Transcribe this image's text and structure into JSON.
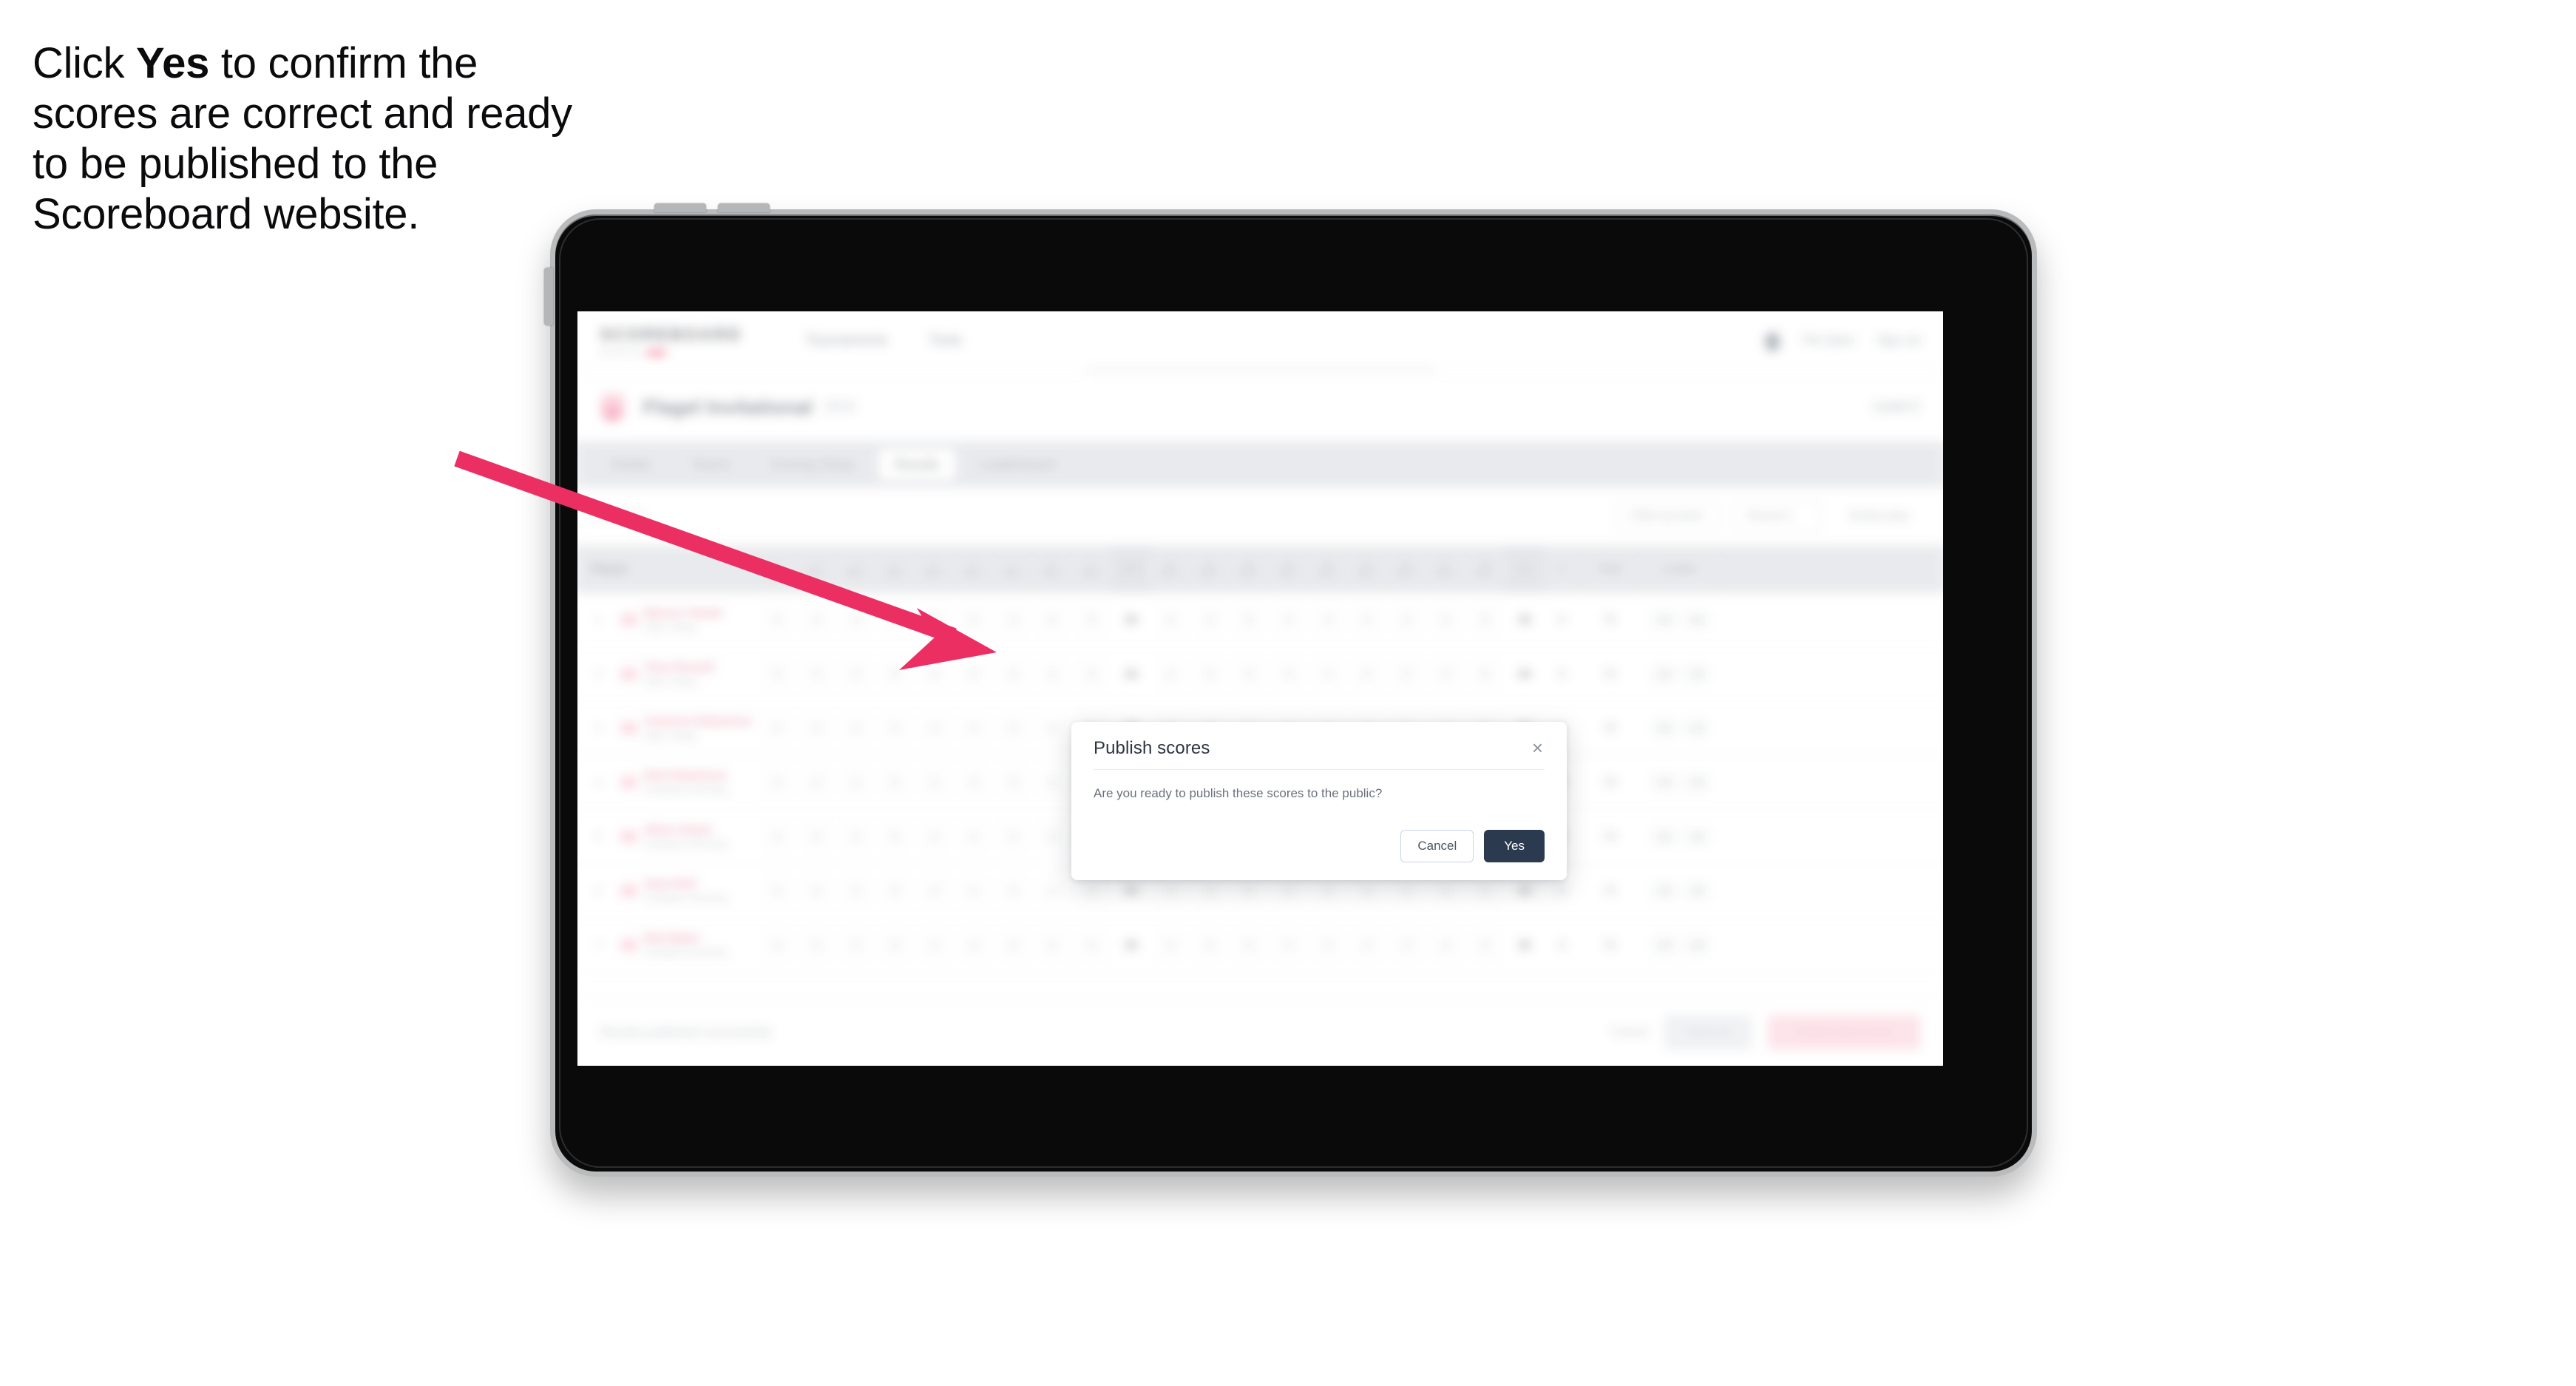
{
  "caption": {
    "before": "Click ",
    "emphasis": "Yes",
    "after": " to confirm the scores are correct and ready to be published to the Scoreboard website."
  },
  "annotation": {
    "arrow_color": "#ec2f63",
    "points_to": "Yes"
  },
  "device": {
    "type": "tablet",
    "frame_color": "#b9bbbd",
    "body_color": "#0a0a0a"
  },
  "modal": {
    "title": "Publish scores",
    "body": "Are you ready to publish these scores to the public?",
    "close_label": "×",
    "cancel_label": "Cancel",
    "yes_label": "Yes",
    "yes_color": "#2c3a4f"
  },
  "app": {
    "brand": {
      "name": "SCOREBOARD",
      "tagline": "powered by"
    },
    "topnav": [
      "Tournaments",
      "Tools"
    ],
    "topbar_right": [
      "Bell",
      "The Open",
      "Sign out"
    ],
    "event": {
      "title": "Flagel Invitational",
      "subtitle": "2024",
      "right": "Level 2"
    },
    "tabs": [
      {
        "label": "Details",
        "active": false
      },
      {
        "label": "Teams",
        "active": false
      },
      {
        "label": "Scoring Setup",
        "active": false
      },
      {
        "label": "Results",
        "active": true
      },
      {
        "label": "Leaderboard",
        "active": false
      }
    ],
    "filters": {
      "left": "Round 1",
      "pills": [
        "Filter by team",
        "Round 1",
        "Stroke play"
      ]
    },
    "table": {
      "head_player": "Player",
      "holes": [
        "1",
        "2",
        "3",
        "4",
        "5",
        "6",
        "7",
        "8",
        "9"
      ],
      "hole_pars": [
        "Par 4",
        "Par 4",
        "Par 3",
        "Par 5",
        "Par 4",
        "Par 4",
        "Par 3",
        "Par 4",
        "Par 5"
      ],
      "out_label": "OUT",
      "holes_back": [
        "10",
        "11",
        "12",
        "13",
        "14",
        "15",
        "16",
        "17",
        "18"
      ],
      "hole_pars_back": [
        "Par 4",
        "Par 3",
        "Par 5",
        "Par 4",
        "Par 4",
        "Par 4",
        "Par 3",
        "Par 4",
        "Par 5"
      ],
      "in_label": "IN",
      "r_label": "R",
      "total_label": "Total",
      "leader_label": "Leader",
      "rows": [
        {
          "pos": "1",
          "name": "Marcus Tamati",
          "club": "Elgin College",
          "front": [
            "4",
            "4",
            "3",
            "5",
            "4",
            "4",
            "3",
            "4",
            "5"
          ],
          "out": "36",
          "back": [
            "4",
            "3",
            "5",
            "4",
            "4",
            "4",
            "3",
            "4",
            "5"
          ],
          "in": "36",
          "r": "0",
          "total": "72",
          "leader": [
            "-00",
            "-00"
          ]
        },
        {
          "pos": "2",
          "name": "Theo Russell",
          "club": "Elgin College",
          "front": [
            "4",
            "4",
            "3",
            "5",
            "4",
            "4",
            "3",
            "4",
            "5"
          ],
          "out": "36",
          "back": [
            "4",
            "3",
            "5",
            "4",
            "4",
            "4",
            "3",
            "4",
            "5"
          ],
          "in": "36",
          "r": "0",
          "total": "72",
          "leader": [
            "-00",
            "-00"
          ]
        },
        {
          "pos": "3",
          "name": "Cameron Robertson",
          "club": "Elgin College",
          "front": [
            "4",
            "4",
            "3",
            "5",
            "4",
            "4",
            "3",
            "4",
            "5"
          ],
          "out": "36",
          "back": [
            "4",
            "3",
            "5",
            "4",
            "4",
            "4",
            "3",
            "4",
            "5"
          ],
          "in": "36",
          "r": "0",
          "total": "72",
          "leader": [
            "-00",
            "-00"
          ]
        },
        {
          "pos": "4",
          "name": "Nick Robertson",
          "club": "Southpark Schooling",
          "front": [
            "4",
            "4",
            "3",
            "5",
            "4",
            "4",
            "3",
            "4",
            "5"
          ],
          "out": "36",
          "back": [
            "4",
            "3",
            "5",
            "4",
            "4",
            "4",
            "3",
            "4",
            "5"
          ],
          "in": "37",
          "r": "0",
          "total": "73",
          "leader": [
            "-00",
            "-00"
          ]
        },
        {
          "pos": "5",
          "name": "Oliver Stuart",
          "club": "Southpark Schooling",
          "front": [
            "4",
            "4",
            "3",
            "5",
            "4",
            "4",
            "3",
            "4",
            "5"
          ],
          "out": "36",
          "back": [
            "4",
            "3",
            "5",
            "4",
            "4",
            "4",
            "3",
            "4",
            "5"
          ],
          "in": "37",
          "r": "0",
          "total": "73",
          "leader": [
            "-00",
            "-00"
          ]
        },
        {
          "pos": "6",
          "name": "Sean Brill",
          "club": "Southpark Schooling",
          "front": [
            "4",
            "4",
            "3",
            "5",
            "4",
            "4",
            "3",
            "4",
            "5"
          ],
          "out": "36",
          "back": [
            "4",
            "3",
            "5",
            "4",
            "4",
            "4",
            "3",
            "4",
            "5"
          ],
          "in": "36",
          "r": "0",
          "total": "72",
          "leader": [
            "-00",
            "-00"
          ]
        },
        {
          "pos": "7",
          "name": "Bob Baker",
          "club": "Southpark Schooling",
          "front": [
            "4",
            "4",
            "3",
            "5",
            "4",
            "4",
            "3",
            "4",
            "5"
          ],
          "out": "36",
          "back": [
            "4",
            "3",
            "5",
            "4",
            "4",
            "4",
            "3",
            "4",
            "5"
          ],
          "in": "36",
          "r": "0",
          "total": "72",
          "leader": [
            "-00",
            "-00"
          ]
        }
      ]
    },
    "footer": {
      "note": "Results published successfully",
      "link": "Cancel",
      "secondary_button": "Save all",
      "primary_button": "Publish final scores"
    }
  }
}
